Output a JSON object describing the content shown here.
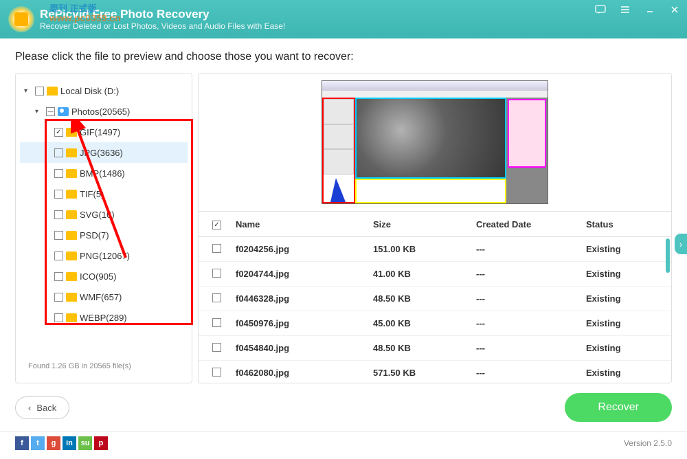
{
  "app": {
    "title": "RePicvid Free Photo Recovery",
    "subtitle": "Recover Deleted or Lost Photos, Videos and Audio Files with Ease!",
    "watermark_blue": "周刊 正式版",
    "watermark_orange": "www.pc0359.cn"
  },
  "instruction": "Please click the file to preview and choose those you want to recover:",
  "tree": {
    "root": {
      "label": "Local Disk (D:)",
      "expanded": true
    },
    "category": {
      "label": "Photos(20565)",
      "expanded": true
    },
    "items": [
      {
        "label": "GIF(1497)",
        "checked": true,
        "selected": false
      },
      {
        "label": "JPG(3636)",
        "checked": false,
        "selected": true
      },
      {
        "label": "BMP(1486)",
        "checked": false,
        "selected": false
      },
      {
        "label": "TIF(5)",
        "checked": false,
        "selected": false
      },
      {
        "label": "SVG(16)",
        "checked": false,
        "selected": false
      },
      {
        "label": "PSD(7)",
        "checked": false,
        "selected": false
      },
      {
        "label": "PNG(12067)",
        "checked": false,
        "selected": false
      },
      {
        "label": "ICO(905)",
        "checked": false,
        "selected": false
      },
      {
        "label": "WMF(657)",
        "checked": false,
        "selected": false
      },
      {
        "label": "WEBP(289)",
        "checked": false,
        "selected": false
      }
    ],
    "footer": "Found 1.26 GB in 20565 file(s)"
  },
  "table": {
    "headers": {
      "name": "Name",
      "size": "Size",
      "date": "Created Date",
      "status": "Status"
    },
    "rows": [
      {
        "name": "f0204256.jpg",
        "size": "151.00 KB",
        "date": "---",
        "status": "Existing"
      },
      {
        "name": "f0204744.jpg",
        "size": "41.00 KB",
        "date": "---",
        "status": "Existing"
      },
      {
        "name": "f0446328.jpg",
        "size": "48.50 KB",
        "date": "---",
        "status": "Existing"
      },
      {
        "name": "f0450976.jpg",
        "size": "45.00 KB",
        "date": "---",
        "status": "Existing"
      },
      {
        "name": "f0454840.jpg",
        "size": "48.50 KB",
        "date": "---",
        "status": "Existing"
      },
      {
        "name": "f0462080.jpg",
        "size": "571.50 KB",
        "date": "---",
        "status": "Existing"
      }
    ]
  },
  "buttons": {
    "back": "Back",
    "recover": "Recover"
  },
  "footer": {
    "version": "Version 2.5.0"
  },
  "social": [
    {
      "label": "f",
      "color": "#3b5998"
    },
    {
      "label": "t",
      "color": "#55acee"
    },
    {
      "label": "g",
      "color": "#dd4b39"
    },
    {
      "label": "in",
      "color": "#0077b5"
    },
    {
      "label": "su",
      "color": "#6cc04a"
    },
    {
      "label": "p",
      "color": "#bd081c"
    }
  ]
}
